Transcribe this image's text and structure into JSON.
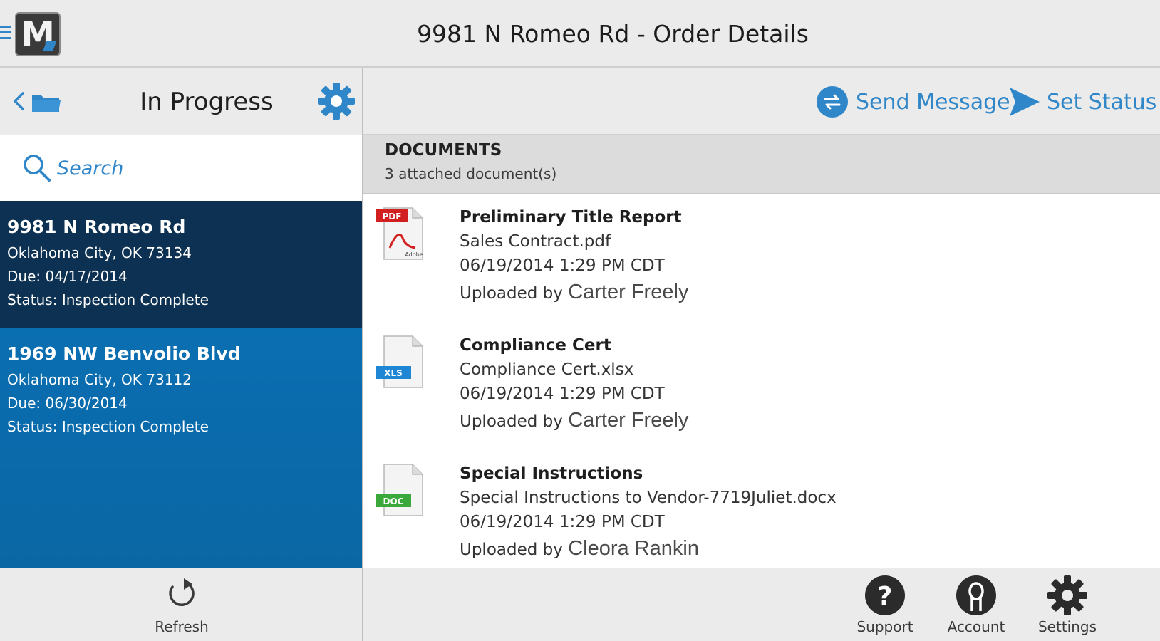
{
  "window": {
    "title": "9981 N Romeo Rd - Order Details"
  },
  "left_pane": {
    "title": "In Progress",
    "search_placeholder": "Search",
    "orders": [
      {
        "street": "9981 N Romeo Rd",
        "city": "Oklahoma City, OK 73134",
        "due": "Due: 04/17/2014",
        "status": "Status: Inspection Complete",
        "selected": true
      },
      {
        "street": "1969 NW Benvolio Blvd",
        "city": "Oklahoma City, OK 73112",
        "due": "Due: 06/30/2014",
        "status": "Status: Inspection Complete",
        "selected": false
      }
    ],
    "refresh_label": "Refresh"
  },
  "right_pane": {
    "actions": {
      "send_message": "Send Message",
      "set_status": "Set Status"
    },
    "documents": {
      "heading": "DOCUMENTS",
      "count_text": "3 attached document(s)",
      "items": [
        {
          "type_badge": "PDF",
          "badge_sub": "Adobe",
          "name": "Preliminary Title Report",
          "file": "Sales Contract.pdf",
          "date": "06/19/2014 1:29 PM CDT",
          "uploaded_prefix": "Uploaded by",
          "uploader": "Carter Freely"
        },
        {
          "type_badge": "XLS",
          "name": "Compliance Cert",
          "file": "Compliance Cert.xlsx",
          "date": "06/19/2014 1:29 PM CDT",
          "uploaded_prefix": "Uploaded by",
          "uploader": "Carter Freely"
        },
        {
          "type_badge": "DOC",
          "name": "Special Instructions",
          "file": "Special Instructions to Vendor-7719Juliet.docx",
          "date": "06/19/2014 1:29 PM CDT",
          "uploaded_prefix": "Uploaded by",
          "uploader": "Cleora Rankin"
        }
      ]
    },
    "footer": {
      "support": "Support",
      "account": "Account",
      "settings": "Settings"
    }
  },
  "logo_letter": "M",
  "colors": {
    "accent": "#2f86c8",
    "selected_row": "#0d3152",
    "list_bg": "#0b70b3",
    "bar_bg": "#ebebeb"
  }
}
